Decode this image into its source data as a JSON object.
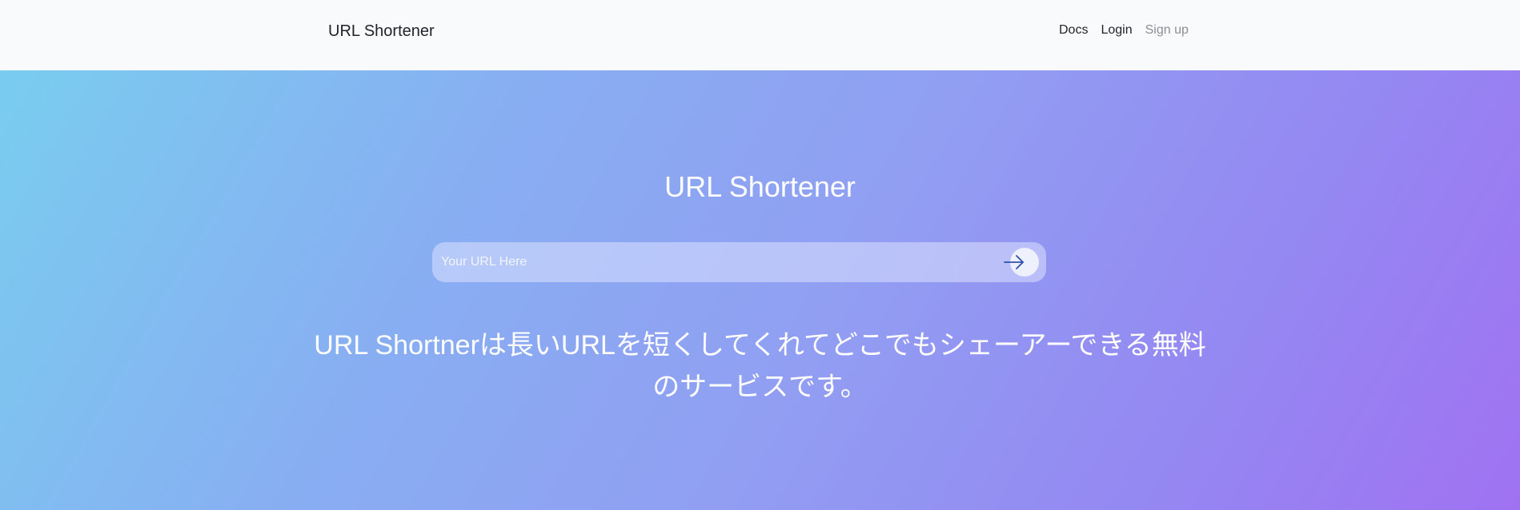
{
  "navbar": {
    "brand": "URL Shortener",
    "links": [
      {
        "label": "Docs"
      },
      {
        "label": "Login"
      },
      {
        "label": "Sign up"
      }
    ]
  },
  "hero": {
    "title": "URL Shortener",
    "search": {
      "placeholder": "Your URL Here",
      "value": "",
      "submit_icon": "arrow-right-icon"
    },
    "description": "URL Shortnerは長いURLを短くしてくれてどこでもシェーアーできる無料のサービスです。"
  },
  "colors": {
    "navbar_bg": "#f9fafb",
    "gradient_start": "#79cdef",
    "gradient_end": "#a072f2",
    "arrow": "#2f4fb0",
    "muted_link": "#8b8f94"
  }
}
